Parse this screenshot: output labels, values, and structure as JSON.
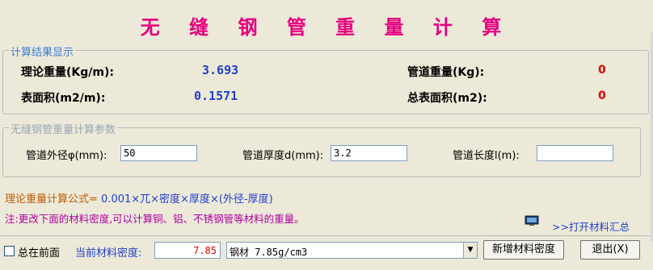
{
  "title": "无 缝 钢 管 重 量 计 算",
  "results": {
    "legend": "计算结果显示",
    "theory_weight_label": "理论重量(Kg/m):",
    "theory_weight_value": "3.693",
    "pipe_weight_label": "管道重量(Kg):",
    "pipe_weight_value": "0",
    "surface_area_label": "表面积(m2/m):",
    "surface_area_value": "0.1571",
    "total_area_label": "总表面积(m2):",
    "total_area_value": "0"
  },
  "params": {
    "legend": "无缝钢管重量计算参数",
    "outer_diameter_label": "管道外径φ(mm):",
    "outer_diameter_value": "50",
    "thickness_label": "管道厚度d(mm):",
    "thickness_value": "3.2",
    "length_label": "管道长度l(m):",
    "length_value": ""
  },
  "formula": {
    "label": "理论重量计算公式=",
    "expression": "0.001×兀×密度×厚度×(外径-厚度)"
  },
  "note": "注:更改下面的材料密度,可以计算铜、铝、不锈钢管等材料的重量。",
  "open_materials_link": ">>打开材料汇总",
  "bottom": {
    "always_on_top_label": "总在前面",
    "always_on_top_checked": false,
    "density_label": "当前材料密度:",
    "density_value": "7.85",
    "material_selected": "钢材 7.85g/cm3",
    "add_density_button": "新增材料密度",
    "exit_button": "退出(X)"
  },
  "colors": {
    "title": "#e5007f",
    "blue_value": "#1f3fcf",
    "red_value": "#e00000",
    "formula_label": "#c05a00",
    "note": "#b000a0"
  },
  "icons": {
    "monitor": "monitor-icon",
    "dropdown": "chevron-down-icon"
  }
}
